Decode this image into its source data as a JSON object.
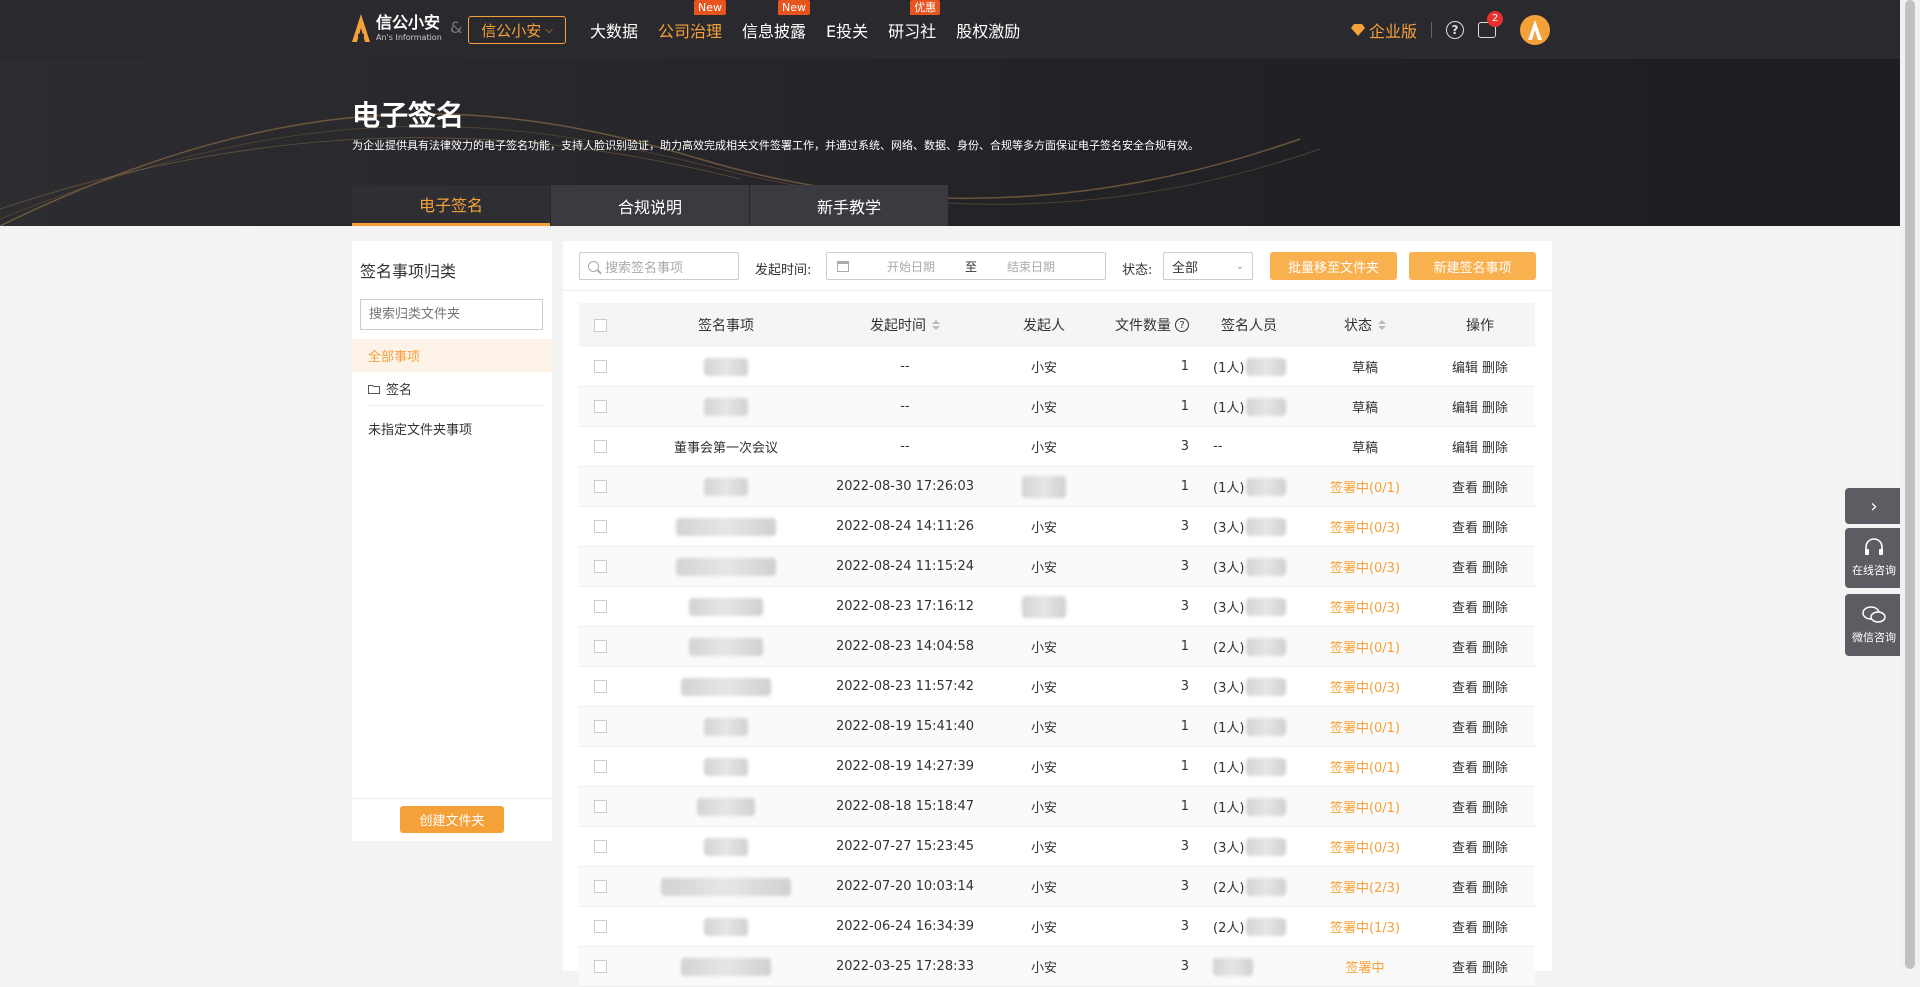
{
  "nav": {
    "logo_cn": "信公小安",
    "logo_en": "An's Information",
    "amp": "&",
    "org": "信公小安",
    "items": [
      {
        "label": "大数据",
        "badge": ""
      },
      {
        "label": "公司治理",
        "badge": "New"
      },
      {
        "label": "信息披露",
        "badge": "New"
      },
      {
        "label": "E投关",
        "badge": ""
      },
      {
        "label": "研习社",
        "badge": "优惠"
      },
      {
        "label": "股权激励",
        "badge": ""
      }
    ],
    "enterprise": "企业版",
    "help": "?",
    "msg_count": "2"
  },
  "banner": {
    "title": "电子签名",
    "desc": "为企业提供具有法律效力的电子签名功能，支持人脸识别验证，助力高效完成相关文件签署工作，并通过系统、网络、数据、身份、合规等多方面保证电子签名安全合规有效。",
    "tabs": [
      "电子签名",
      "合规说明",
      "新手教学"
    ]
  },
  "sidebar": {
    "title": "签名事项归类",
    "search_placeholder": "搜索归类文件夹",
    "items": [
      "全部事项",
      "签名",
      "未指定文件夹事项"
    ],
    "create_button": "创建文件夹"
  },
  "toolbar": {
    "search_placeholder": "搜索签名事项",
    "time_label": "发起时间:",
    "start_placeholder": "开始日期",
    "to": "至",
    "end_placeholder": "结束日期",
    "status_label": "状态:",
    "status_value": "全部",
    "batch_move": "批量移至文件夹",
    "new_item": "新建签名事项"
  },
  "table": {
    "headers": {
      "name": "签名事项",
      "time": "发起时间",
      "initiator": "发起人",
      "count": "文件数量",
      "signers": "签名人员",
      "status": "状态",
      "ops": "操作"
    },
    "rows": [
      {
        "name": "",
        "time": "--",
        "initiator": "小安",
        "count": "1",
        "signers": "(1人)",
        "status": "草稿",
        "ops": [
          "编辑",
          "删除"
        ]
      },
      {
        "name": "",
        "time": "--",
        "initiator": "小安",
        "count": "1",
        "signers": "(1人)",
        "status": "草稿",
        "ops": [
          "编辑",
          "删除"
        ]
      },
      {
        "name": "董事会第一次会议",
        "time": "--",
        "initiator": "小安",
        "count": "3",
        "signers": "--",
        "status": "草稿",
        "ops": [
          "编辑",
          "删除"
        ]
      },
      {
        "name": "",
        "time": "2022-08-30 17:26:03",
        "initiator": "",
        "count": "1",
        "signers": "(1人)",
        "status": "签署中(0/1)",
        "ops": [
          "查看",
          "删除"
        ]
      },
      {
        "name": "",
        "time": "2022-08-24 14:11:26",
        "initiator": "小安",
        "count": "3",
        "signers": "(3人)",
        "status": "签署中(0/3)",
        "ops": [
          "查看",
          "删除"
        ]
      },
      {
        "name": "",
        "time": "2022-08-24 11:15:24",
        "initiator": "小安",
        "count": "3",
        "signers": "(3人)",
        "status": "签署中(0/3)",
        "ops": [
          "查看",
          "删除"
        ]
      },
      {
        "name": "",
        "time": "2022-08-23 17:16:12",
        "initiator": "",
        "count": "3",
        "signers": "(3人)",
        "status": "签署中(0/3)",
        "ops": [
          "查看",
          "删除"
        ]
      },
      {
        "name": "",
        "time": "2022-08-23 14:04:58",
        "initiator": "小安",
        "count": "1",
        "signers": "(2人)",
        "status": "签署中(0/1)",
        "ops": [
          "查看",
          "删除"
        ]
      },
      {
        "name": "",
        "time": "2022-08-23 11:57:42",
        "initiator": "小安",
        "count": "3",
        "signers": "(3人)",
        "status": "签署中(0/3)",
        "ops": [
          "查看",
          "删除"
        ]
      },
      {
        "name": "",
        "time": "2022-08-19 15:41:40",
        "initiator": "小安",
        "count": "1",
        "signers": "(1人)",
        "status": "签署中(0/1)",
        "ops": [
          "查看",
          "删除"
        ]
      },
      {
        "name": "",
        "time": "2022-08-19 14:27:39",
        "initiator": "小安",
        "count": "1",
        "signers": "(1人)",
        "status": "签署中(0/1)",
        "ops": [
          "查看",
          "删除"
        ]
      },
      {
        "name": "",
        "time": "2022-08-18 15:18:47",
        "initiator": "小安",
        "count": "1",
        "signers": "(1人)",
        "status": "签署中(0/1)",
        "ops": [
          "查看",
          "删除"
        ]
      },
      {
        "name": "",
        "time": "2022-07-27 15:23:45",
        "initiator": "小安",
        "count": "3",
        "signers": "(3人)",
        "status": "签署中(0/3)",
        "ops": [
          "查看",
          "删除"
        ]
      },
      {
        "name": "",
        "time": "2022-07-20 10:03:14",
        "initiator": "小安",
        "count": "3",
        "signers": "(2人)",
        "status": "签署中(2/3)",
        "ops": [
          "查看",
          "删除"
        ]
      },
      {
        "name": "",
        "time": "2022-06-24 16:34:39",
        "initiator": "小安",
        "count": "3",
        "signers": "(2人)",
        "status": "签署中(1/3)",
        "ops": [
          "查看",
          "删除"
        ]
      },
      {
        "name": "",
        "time": "2022-03-25 17:28:33",
        "initiator": "小安",
        "count": "3",
        "signers": "",
        "status": "签署中",
        "ops": [
          "查看",
          "删除"
        ]
      }
    ]
  },
  "float": {
    "online": "在线咨询",
    "wechat": "微信咨询"
  },
  "colors": {
    "accent": "#f5a13a",
    "nav_bg": "#2a2a2e"
  }
}
